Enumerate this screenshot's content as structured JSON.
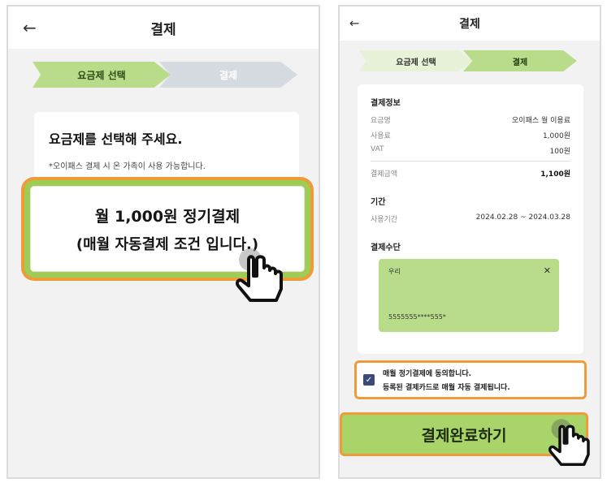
{
  "left_screen": {
    "title": "결제",
    "steps": [
      {
        "label": "요금제 선택",
        "state": "active"
      },
      {
        "label": "결제",
        "state": "inactive"
      }
    ],
    "plan_card": {
      "heading": "요금제를 선택해 주세요.",
      "note": "*오이패스 결제 시 온 가족이 사용 가능합니다."
    },
    "plan_option": {
      "line1": "월 1,000원 정기결제",
      "line2": "(매월 자동결제 조건 입니다.)"
    }
  },
  "right_screen": {
    "title": "결제",
    "steps": [
      {
        "label": "요금제 선택",
        "state": "done"
      },
      {
        "label": "결제",
        "state": "current"
      }
    ],
    "payment_info": {
      "title": "결제정보",
      "rows": [
        {
          "label": "요금명",
          "value": "오이패스 월 이용료"
        },
        {
          "label": "사용료",
          "value": "1,000원"
        },
        {
          "label": "VAT",
          "value": "100원"
        }
      ],
      "total": {
        "label": "결제금액",
        "value": "1,100원"
      }
    },
    "period": {
      "title": "기간",
      "label": "사용기간",
      "value": "2024.02.28 ~ 2024.03.28"
    },
    "payment_method": {
      "title": "결제수단",
      "card_bank": "우리",
      "card_number": "5555555****555*"
    },
    "agreement": {
      "checked": true,
      "line1": "매월 정기결제에 동의합니다.",
      "line2": "등록된 결제카드로 매월 자동 결제됩니다."
    },
    "complete_button": "결제완료하기"
  },
  "colors": {
    "accent_green": "#b9dc8a",
    "highlight_orange": "#ee9c3a",
    "inactive_step": "#d6dbe1"
  }
}
